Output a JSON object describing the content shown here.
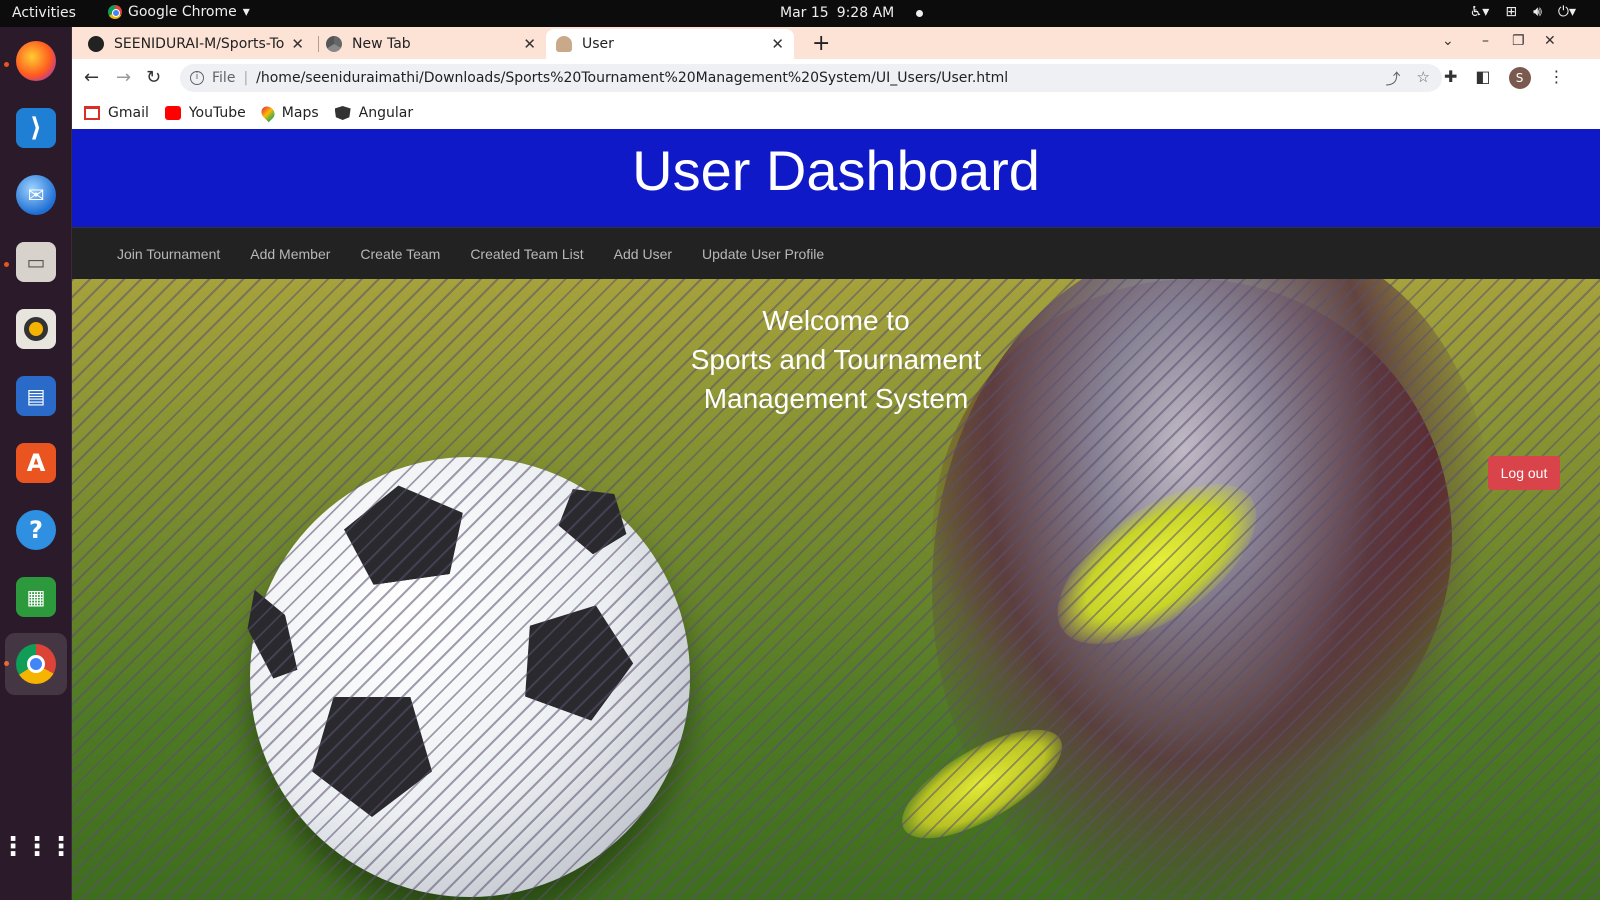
{
  "system_bar": {
    "activities": "Activities",
    "app_name": "Google Chrome",
    "date": "Mar 15",
    "time": "9:28 AM"
  },
  "dock": {
    "apps": [
      "firefox",
      "vscode",
      "thunderbird",
      "files",
      "rhythmbox",
      "writer",
      "software",
      "help",
      "calc",
      "chrome",
      "show-apps"
    ]
  },
  "browser": {
    "tabs": [
      {
        "title": "SEENIDURAI-M/Sports-To",
        "icon": "github-icon",
        "active": false
      },
      {
        "title": "New Tab",
        "icon": "chrome-icon",
        "active": false
      },
      {
        "title": "User",
        "icon": "user-icon",
        "active": true
      }
    ],
    "address": {
      "scheme": "File",
      "url": "/home/seeniduraimathi/Downloads/Sports%20Tournament%20Management%20System/UI_Users/User.html"
    },
    "profile_initial": "S",
    "bookmarks": [
      {
        "label": "Gmail",
        "icon": "gmail-icon"
      },
      {
        "label": "YouTube",
        "icon": "youtube-icon"
      },
      {
        "label": "Maps",
        "icon": "maps-icon"
      },
      {
        "label": "Angular",
        "icon": "angular-icon"
      }
    ]
  },
  "page": {
    "header_title": "User Dashboard",
    "nav": [
      "Join Tournament",
      "Add Member",
      "Create Team",
      "Created Team List",
      "Add User",
      "Update User Profile"
    ],
    "welcome": [
      "Welcome to",
      "Sports and Tournament",
      "Management System"
    ],
    "logout_label": "Log out",
    "colors": {
      "header_bg": "#0f19c8",
      "navbar_bg": "#222222",
      "logout_bg": "#d9434a"
    }
  }
}
